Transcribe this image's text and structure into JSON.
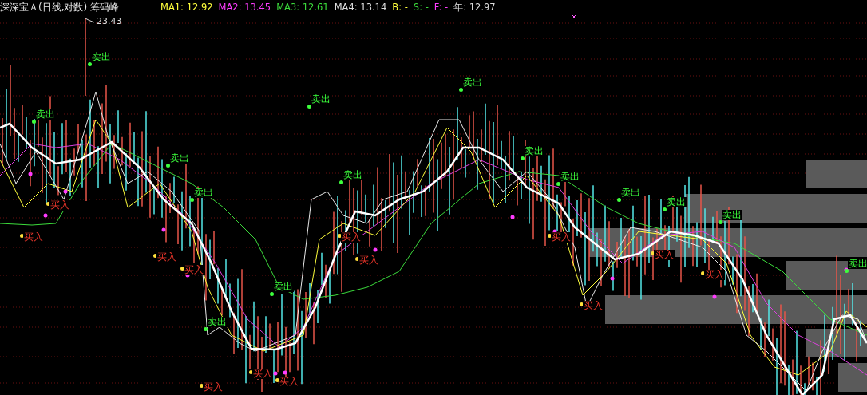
{
  "header": {
    "title": "深深宝Ａ(日线,对数) 筹码峰",
    "indicators": [
      {
        "text": "MA1: 12.92",
        "color": "#ffff3c"
      },
      {
        "text": "MA2: 13.45",
        "color": "#ff3cff"
      },
      {
        "text": "MA3: 12.61",
        "color": "#3cdc3c"
      },
      {
        "text": "MA4: 13.14",
        "color": "#dcdcdc"
      },
      {
        "text": "B: -",
        "color": "#ffff3c"
      },
      {
        "text": "S: -",
        "color": "#3cdc3c"
      },
      {
        "text": "F: -",
        "color": "#ff3cff"
      },
      {
        "text": "年: 12.97",
        "color": "#dcdcdc"
      }
    ]
  },
  "chart": {
    "peak_label": "23.43",
    "signals": [
      {
        "kind": "sell",
        "text": "卖出"
      },
      {
        "kind": "sell",
        "text": "卖出"
      },
      {
        "kind": "sell",
        "text": "卖出"
      },
      {
        "kind": "sell",
        "text": "卖出"
      },
      {
        "kind": "sell",
        "text": "卖出"
      },
      {
        "kind": "sell",
        "text": "卖出"
      },
      {
        "kind": "sell",
        "text": "卖出"
      },
      {
        "kind": "sell",
        "text": "卖出"
      },
      {
        "kind": "sell",
        "text": "卖出"
      },
      {
        "kind": "sell",
        "text": "卖出"
      },
      {
        "kind": "sell",
        "text": "卖出"
      },
      {
        "kind": "buy",
        "text": "买入"
      },
      {
        "kind": "sell",
        "text": "卖出"
      },
      {
        "kind": "buy",
        "text": "买入"
      },
      {
        "kind": "buy",
        "text": "买入"
      },
      {
        "kind": "buy",
        "text": "买入"
      },
      {
        "kind": "buy",
        "text": "买入"
      },
      {
        "kind": "buy",
        "text": "买入"
      },
      {
        "kind": "buy",
        "text": "买入"
      },
      {
        "kind": "sell",
        "text": "卖出"
      },
      {
        "kind": "buy",
        "text": "买入"
      },
      {
        "kind": "buy",
        "text": "买入"
      },
      {
        "kind": "sell",
        "text": "卖出"
      },
      {
        "kind": "buy",
        "text": "买入"
      },
      {
        "kind": "sell",
        "text": "卖出"
      },
      {
        "kind": "buy",
        "text": "买入"
      },
      {
        "kind": "buy",
        "text": "买入"
      },
      {
        "kind": "buy",
        "text": "买入"
      }
    ]
  }
}
